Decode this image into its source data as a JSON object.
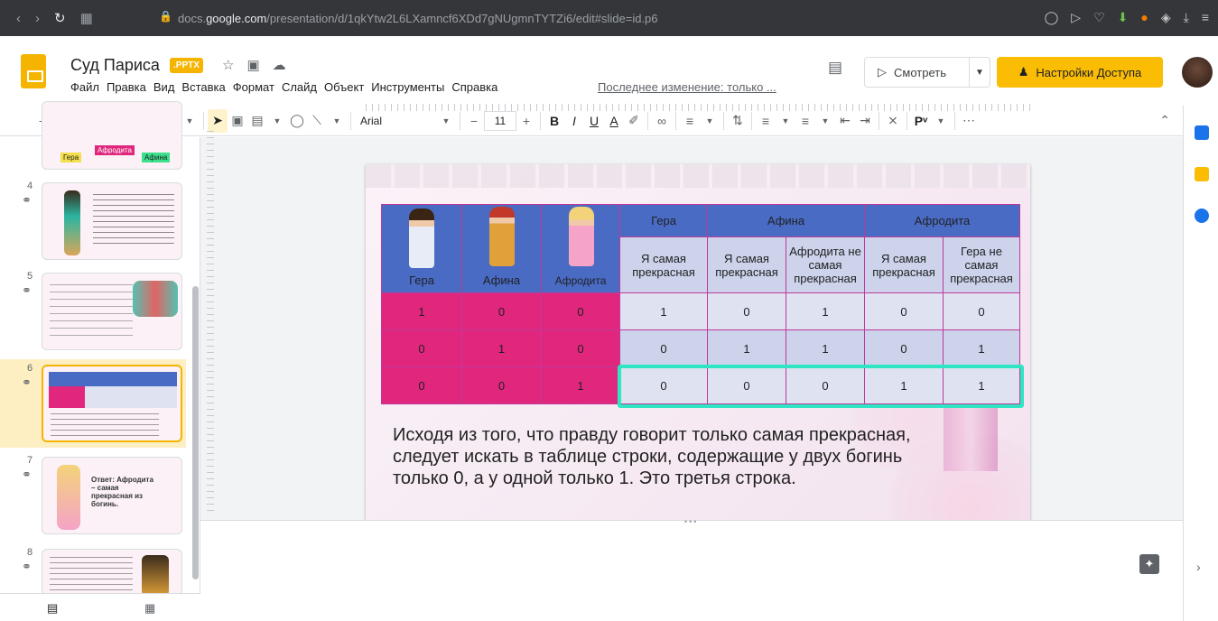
{
  "browser": {
    "url_prefix": "docs.",
    "url_domain": "google.com",
    "url_path": "/presentation/d/1qkYtw2L6LXamncf6XDd7gNUgmnTYTZi6/edit#slide=id.p6"
  },
  "doc": {
    "title": "Суд Париса",
    "badge": ".PPTX",
    "last_edit": "Последнее изменение: только ..."
  },
  "menu": [
    "Файл",
    "Правка",
    "Вид",
    "Вставка",
    "Формат",
    "Слайд",
    "Объект",
    "Инструменты",
    "Справка"
  ],
  "header": {
    "present_label": "Смотреть",
    "share_label": "Настройки Доступа"
  },
  "toolbar": {
    "font": "Arial",
    "font_size": "11"
  },
  "thumbnails": [
    {
      "num": "4"
    },
    {
      "num": "5"
    },
    {
      "num": "6"
    },
    {
      "num": "7",
      "text": "Ответ: Афродита – самая прекрасная из богинь."
    },
    {
      "num": "8"
    }
  ],
  "thumb_labels": {
    "hera": "Гера",
    "aphrodite": "Афродита",
    "athena": "Афина"
  },
  "slide": {
    "table": {
      "col_heads": [
        "Гера",
        "Афина",
        "Афродита"
      ],
      "group_heads": [
        "Гера",
        "Афина",
        "Афродита"
      ],
      "sub_heads": [
        "Я самая прекрасная",
        "Я самая прекрасная",
        "Афродита не самая прекрасная",
        "Я самая прекрасная",
        "Гера не самая прекрасная"
      ],
      "rows": [
        [
          "1",
          "0",
          "0",
          "1",
          "0",
          "1",
          "0",
          "0"
        ],
        [
          "0",
          "1",
          "0",
          "0",
          "1",
          "1",
          "0",
          "1"
        ],
        [
          "0",
          "0",
          "1",
          "0",
          "0",
          "0",
          "1",
          "1"
        ]
      ]
    },
    "text": "Исходя из того, что правду говорит только самая прекрасная, следует искать в таблице строки, содержащие у двух богинь только 0, а у одной только 1. Это третья строка."
  },
  "colors": {
    "share": "#fbbc04",
    "pink": "#e0277d",
    "blue": "#4a6bc4",
    "highlight": "#2ee6c3"
  }
}
